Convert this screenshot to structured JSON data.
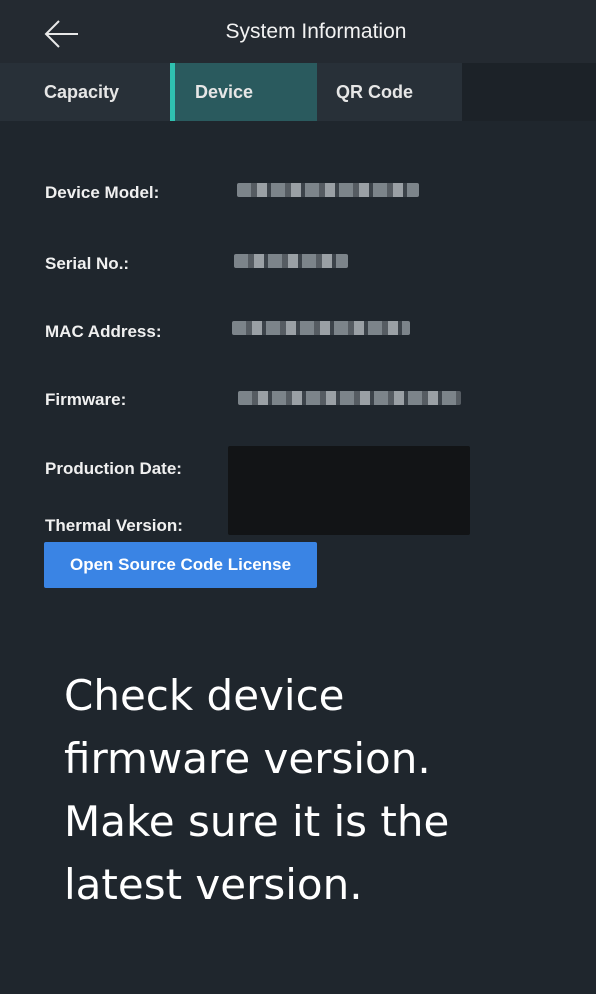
{
  "header": {
    "title": "System Information",
    "back_icon": "arrow-left-icon"
  },
  "tabs": [
    {
      "label": "Capacity",
      "active": false
    },
    {
      "label": "Device",
      "active": true
    },
    {
      "label": "QR Code",
      "active": false
    }
  ],
  "device_info": {
    "model_label": "Device Model:",
    "serial_label": "Serial No.:",
    "mac_label": "MAC Address:",
    "firmware_label": "Firmware:",
    "production_date_label": "Production Date:",
    "thermal_version_label": "Thermal Version:"
  },
  "license_button": "Open Source Code License",
  "caption": "Check device firmware version. Make sure it is the latest version.",
  "colors": {
    "background": "#1f262d",
    "active_tab": "#2a5a5e",
    "active_tab_indicator": "#2fc0b0",
    "button": "#3a84e4"
  }
}
